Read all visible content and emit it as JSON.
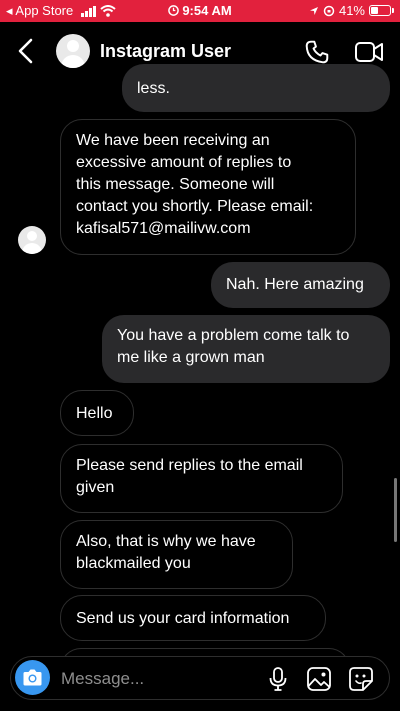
{
  "status_bar": {
    "back_app": "◂ App Store",
    "time": "9:54 AM",
    "battery": "41%",
    "background_color": "#e2213d"
  },
  "header": {
    "title": "Instagram User",
    "icons": [
      "back-arrow-icon",
      "avatar",
      "phone-icon",
      "video-camera-icon"
    ]
  },
  "messages": [
    {
      "direction": "outgoing",
      "text": "less."
    },
    {
      "direction": "incoming",
      "text": "We have been receiving an\nexcessive amount of replies to\nthis message. Someone will\ncontact you shortly. Please email:\nkafisal571@mailivw.com"
    },
    {
      "direction": "outgoing",
      "text": "Nah. Here amazing"
    },
    {
      "direction": "outgoing",
      "text": "You have a problem come talk to\nme like a grown man"
    },
    {
      "direction": "incoming",
      "text": "Hello"
    },
    {
      "direction": "incoming",
      "text": "Please send replies to the email\ngiven"
    },
    {
      "direction": "incoming",
      "text": "Also, that is why we have\nblackmailed you"
    },
    {
      "direction": "incoming",
      "text": "Send us your card information"
    }
  ],
  "composer": {
    "placeholder": "Message...",
    "accent_color": "#3897f0",
    "icons": [
      "camera-icon",
      "microphone-icon",
      "gallery-icon",
      "sticker-icon"
    ]
  }
}
